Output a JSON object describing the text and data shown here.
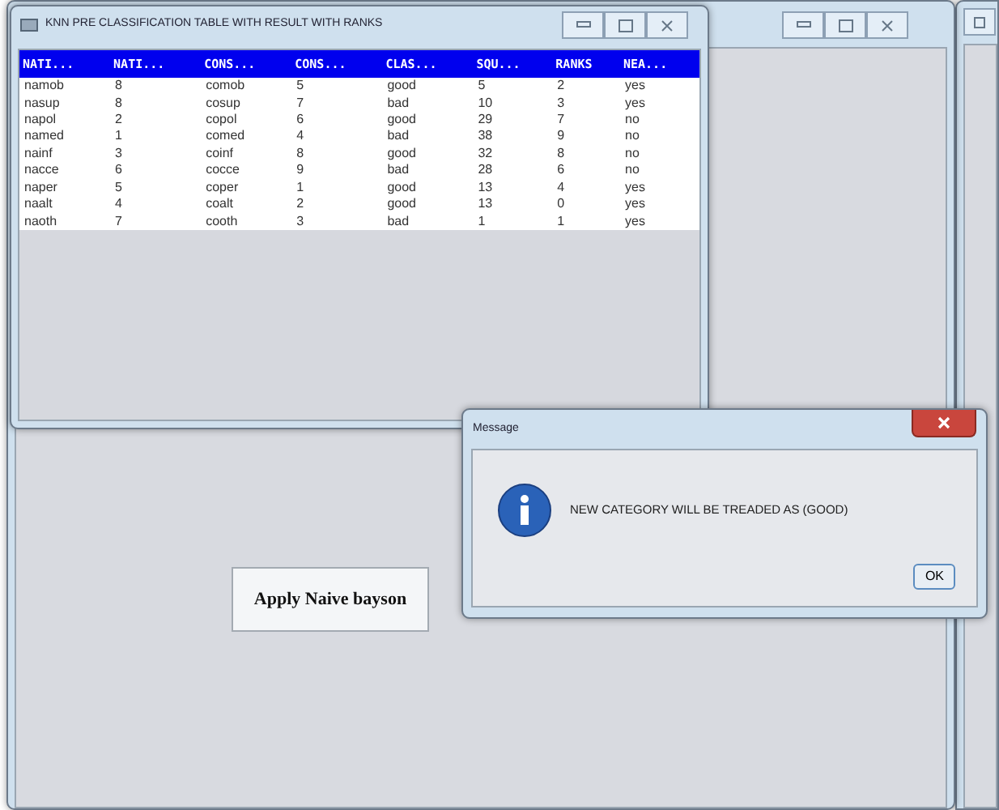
{
  "table_window": {
    "title": "KNN PRE CLASSIFICATION TABLE WITH RESULT WITH RANKS",
    "table": {
      "columns": [
        "NATI...",
        "NATI...",
        "CONS...",
        "CONS...",
        "CLAS...",
        "SQU...",
        "RANKS",
        "NEA..."
      ],
      "rows": [
        [
          "namob",
          "8",
          "comob",
          "5",
          "good",
          "5",
          "2",
          "yes"
        ],
        [
          "nasup",
          "8",
          "cosup",
          "7",
          "bad",
          "10",
          "3",
          "yes"
        ],
        [
          "napol",
          "2",
          "copol",
          "6",
          "good",
          "29",
          "7",
          "no"
        ],
        [
          "named",
          "1",
          "comed",
          "4",
          "bad",
          "38",
          "9",
          "no"
        ],
        [
          "nainf",
          "3",
          "coinf",
          "8",
          "good",
          "32",
          "8",
          "no"
        ],
        [
          "nacce",
          "6",
          "cocce",
          "9",
          "bad",
          "28",
          "6",
          "no"
        ],
        [
          "naper",
          "5",
          "coper",
          "1",
          "good",
          "13",
          "4",
          "yes"
        ],
        [
          "naalt",
          "4",
          "coalt",
          "2",
          "good",
          "13",
          "0",
          "yes"
        ],
        [
          "naoth",
          "7",
          "cooth",
          "3",
          "bad",
          "1",
          "1",
          "yes"
        ]
      ]
    }
  },
  "main_window": {
    "button": "Apply Naive bayson"
  },
  "message_dialog": {
    "title": "Message",
    "text": "NEW CATEGORY WILL BE TREADED AS (GOOD)",
    "button": "OK"
  }
}
